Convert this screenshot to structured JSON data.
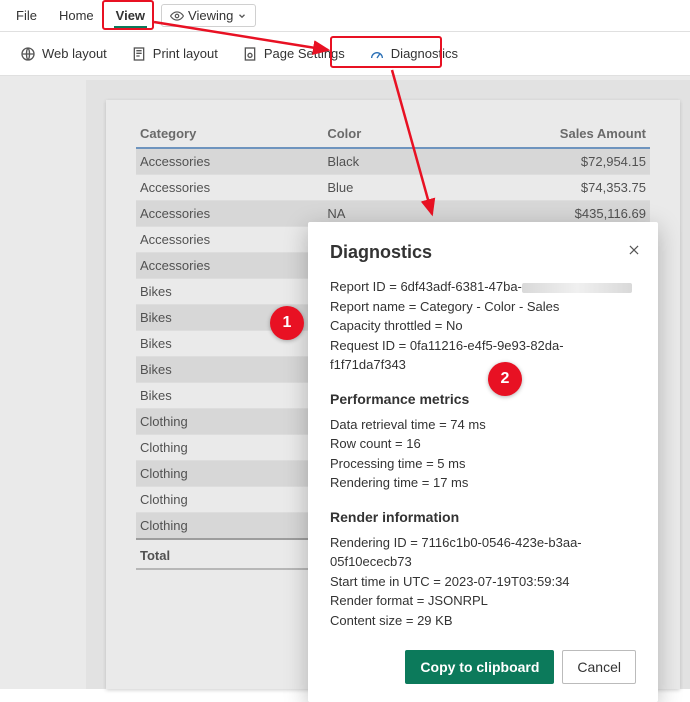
{
  "menubar": {
    "file": "File",
    "home": "Home",
    "view": "View",
    "viewing": "Viewing"
  },
  "toolbar": {
    "web_layout": "Web layout",
    "print_layout": "Print layout",
    "page_settings": "Page Settings",
    "diagnostics": "Diagnostics"
  },
  "table": {
    "headers": {
      "category": "Category",
      "color": "Color",
      "sales": "Sales Amount"
    },
    "rows": [
      {
        "category": "Accessories",
        "color": "Black",
        "sales": "$72,954.15",
        "alt": true
      },
      {
        "category": "Accessories",
        "color": "Blue",
        "sales": "$74,353.75",
        "alt": false
      },
      {
        "category": "Accessories",
        "color": "NA",
        "sales": "$435,116.69",
        "alt": true
      },
      {
        "category": "Accessories",
        "color": "",
        "sales": "",
        "alt": false
      },
      {
        "category": "Accessories",
        "color": "",
        "sales": "",
        "alt": true
      },
      {
        "category": "Bikes",
        "color": "",
        "sales": "",
        "alt": false
      },
      {
        "category": "Bikes",
        "color": "",
        "sales": "",
        "alt": true
      },
      {
        "category": "Bikes",
        "color": "",
        "sales": "",
        "alt": false
      },
      {
        "category": "Bikes",
        "color": "",
        "sales": "",
        "alt": true
      },
      {
        "category": "Bikes",
        "color": "",
        "sales": "",
        "alt": false
      },
      {
        "category": "Clothing",
        "color": "",
        "sales": "",
        "alt": true
      },
      {
        "category": "Clothing",
        "color": "",
        "sales": "",
        "alt": false
      },
      {
        "category": "Clothing",
        "color": "",
        "sales": "",
        "alt": true
      },
      {
        "category": "Clothing",
        "color": "",
        "sales": "",
        "alt": false
      },
      {
        "category": "Clothing",
        "color": "",
        "sales": "",
        "alt": true
      }
    ],
    "total_label": "Total"
  },
  "modal": {
    "title": "Diagnostics",
    "info": [
      "Report ID = 6df43adf-6381-47ba-",
      "Report name = Category - Color - Sales",
      "Capacity throttled = No",
      "Request ID = 0fa11216-e4f5-9e93-82da-f1f71da7f343"
    ],
    "perf_header": "Performance metrics",
    "perf": [
      "Data retrieval time = 74 ms",
      "Row count = 16",
      "Processing time = 5 ms",
      "Rendering time = 17 ms"
    ],
    "render_header": "Render information",
    "render": [
      "Rendering ID = 7116c1b0-0546-423e-b3aa-05f10ececb73",
      "Start time in UTC = 2023-07-19T03:59:34",
      "Render format = JSONRPL",
      "Content size = 29 KB"
    ],
    "copy_btn": "Copy to clipboard",
    "cancel_btn": "Cancel"
  },
  "annotations": {
    "one": "1",
    "two": "2"
  }
}
